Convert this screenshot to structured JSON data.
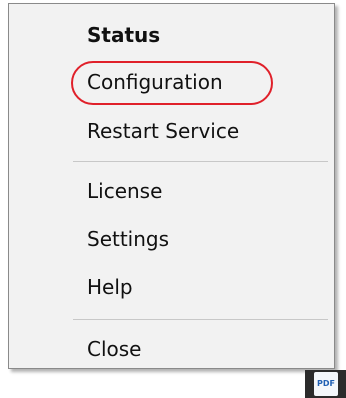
{
  "context_menu": {
    "items": [
      {
        "label": "Status",
        "bold": true
      },
      {
        "label": "Configuration",
        "highlighted": true
      },
      {
        "label": "Restart Service"
      },
      {
        "label": "License"
      },
      {
        "label": "Settings"
      },
      {
        "label": "Help"
      },
      {
        "label": "Close"
      }
    ],
    "highlight_color": "#e0202a"
  },
  "taskbar": {
    "tray_icon": {
      "name": "pdf-icon",
      "label": "PDF"
    }
  }
}
